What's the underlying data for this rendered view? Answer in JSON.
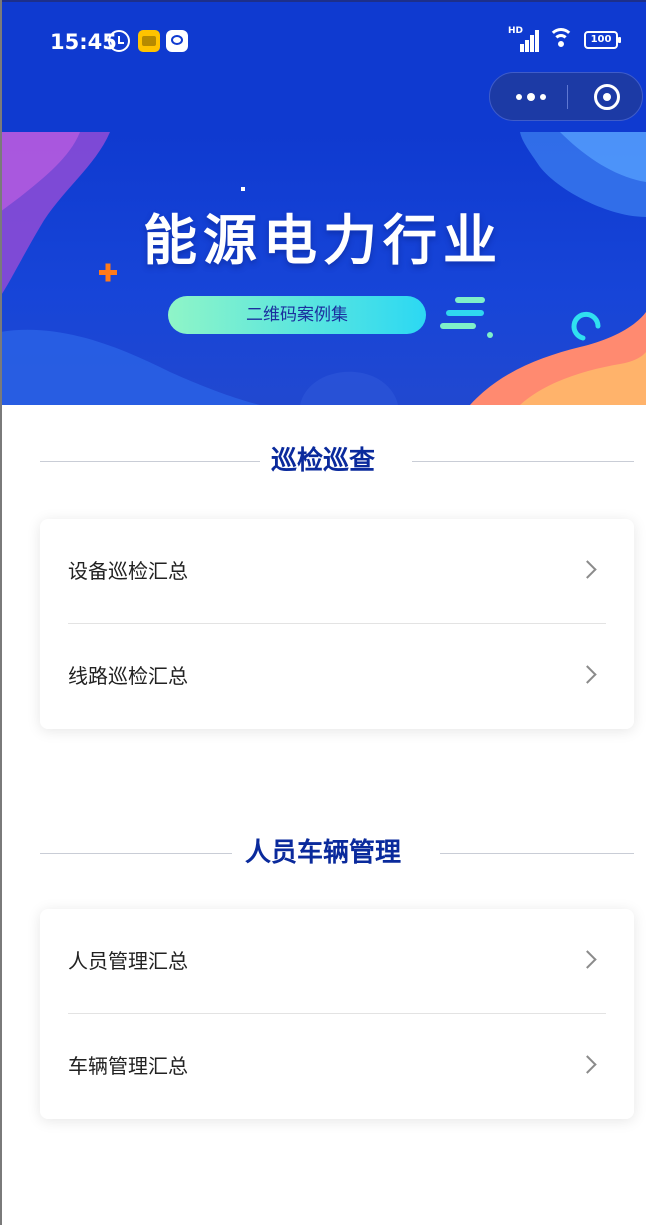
{
  "status_bar": {
    "time": "15:45",
    "network_label": "HD",
    "battery": "100"
  },
  "banner": {
    "title": "能源电力行业",
    "subtitle": "二维码案例集"
  },
  "sections": [
    {
      "title": "巡检巡查",
      "items": [
        {
          "label": "设备巡检汇总"
        },
        {
          "label": "线路巡检汇总"
        }
      ]
    },
    {
      "title": "人员车辆管理",
      "items": [
        {
          "label": "人员管理汇总"
        },
        {
          "label": "车辆管理汇总"
        }
      ]
    }
  ],
  "colors": {
    "nav_background": "#0f3ad0",
    "section_title": "#0a2a9c",
    "pill_gradient_start": "#8ff5c7",
    "pill_gradient_end": "#2cd8f3",
    "accent_orange": "#ff7a1a"
  },
  "icons": {
    "alarm": "alarm-icon",
    "meituan": "meituan-app-icon",
    "chat": "chat-app-icon",
    "signal": "signal-icon",
    "wifi": "wifi-icon",
    "battery": "battery-icon",
    "more": "more-icon",
    "close": "close-miniprogram-icon",
    "chevron": "chevron-right-icon"
  }
}
